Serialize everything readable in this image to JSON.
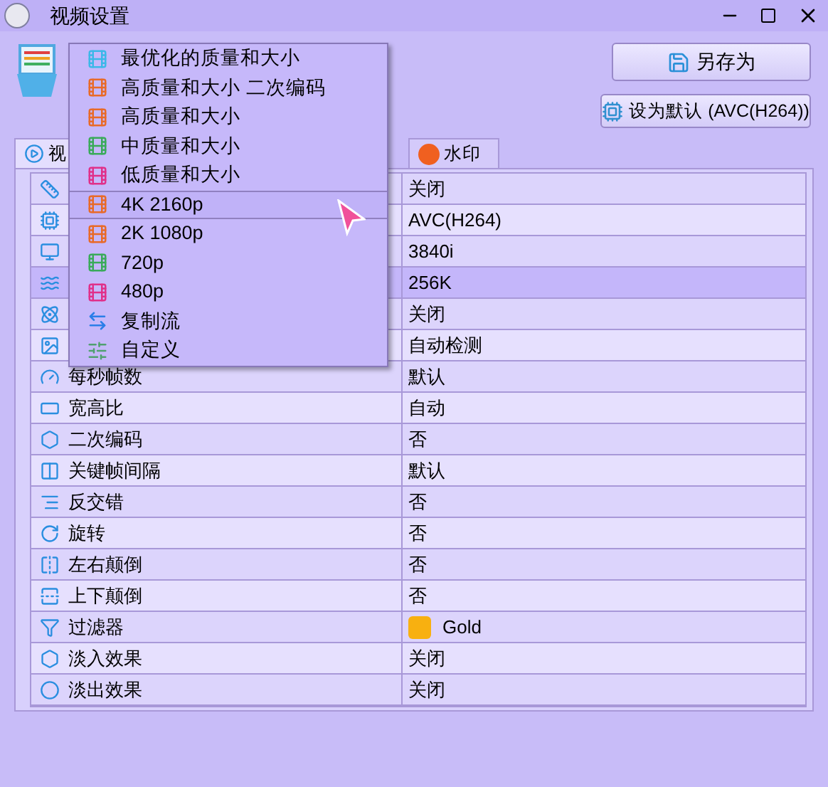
{
  "window": {
    "title": "视频设置"
  },
  "preset_menu": {
    "items": [
      {
        "label": "最优化的质量和大小",
        "kind": "film",
        "color": "#3cb8e8",
        "selected": false
      },
      {
        "label": "高质量和大小 二次编码",
        "kind": "film",
        "color": "#e86a28",
        "selected": false
      },
      {
        "label": "高质量和大小",
        "kind": "film",
        "color": "#e86a28",
        "selected": false
      },
      {
        "label": "中质量和大小",
        "kind": "film",
        "color": "#3aaa5a",
        "selected": false
      },
      {
        "label": "低质量和大小",
        "kind": "film",
        "color": "#e0308a",
        "selected": false
      },
      {
        "label": "4K 2160p",
        "kind": "film",
        "color": "#e86a28",
        "selected": true
      },
      {
        "label": "2K 1080p",
        "kind": "film",
        "color": "#e86a28",
        "selected": false
      },
      {
        "label": "720p",
        "kind": "film",
        "color": "#3aaa5a",
        "selected": false
      },
      {
        "label": "480p",
        "kind": "film",
        "color": "#e0308a",
        "selected": false
      },
      {
        "label": "复制流",
        "kind": "stream",
        "selected": false
      },
      {
        "label": "自定义",
        "kind": "custom",
        "selected": false
      }
    ]
  },
  "buttons": {
    "save_as": "另存为",
    "set_default": "设为默认 (AVC(H264))"
  },
  "tabs": [
    {
      "label": "视",
      "selected": true
    },
    {
      "label": "水印",
      "selected": false
    }
  ],
  "table": {
    "rows": [
      {
        "value": "关闭",
        "selected": false
      },
      {
        "value": "AVC(H264)",
        "selected": false
      },
      {
        "value": "3840i",
        "selected": false
      },
      {
        "value": "256K",
        "selected": true
      },
      {
        "value": "关闭",
        "selected": false
      },
      {
        "value": "自动检测",
        "selected": false
      },
      {
        "label": "每秒帧数",
        "value": "默认",
        "selected": false
      },
      {
        "label": "宽高比",
        "value": "自动",
        "selected": false
      },
      {
        "label": "二次编码",
        "value": "否",
        "selected": false
      },
      {
        "label": "关键帧间隔",
        "value": "默认",
        "selected": false
      },
      {
        "label": "反交错",
        "value": "否",
        "selected": false
      },
      {
        "label": "旋转",
        "value": "否",
        "selected": false
      },
      {
        "label": "左右颠倒",
        "value": "否",
        "selected": false
      },
      {
        "label": "上下颠倒",
        "value": "否",
        "selected": false
      },
      {
        "label": "过滤器",
        "value": "Gold",
        "color": "#f8b010",
        "selected": false
      },
      {
        "label": "淡入效果",
        "value": "关闭",
        "selected": false
      },
      {
        "label": "淡出效果",
        "value": "关闭",
        "selected": false
      }
    ]
  }
}
